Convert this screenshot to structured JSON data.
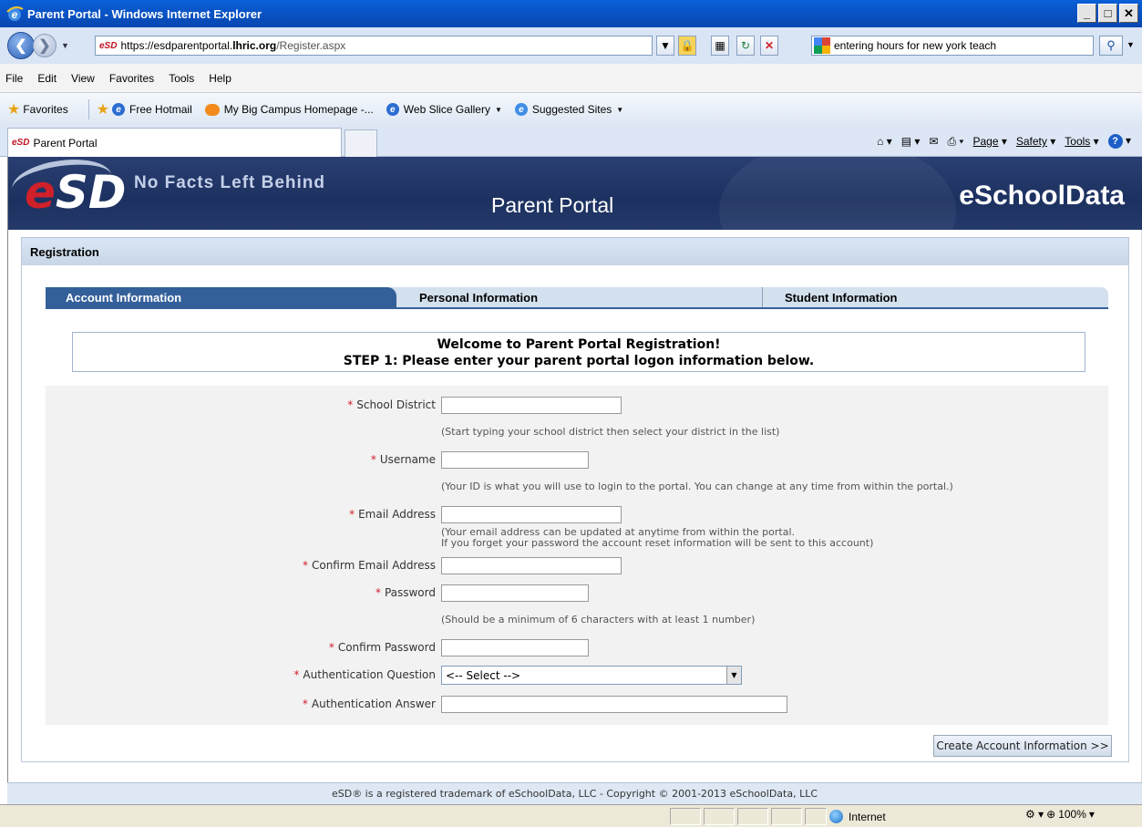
{
  "window": {
    "title": "Parent Portal - Windows Internet Explorer",
    "min": "_",
    "max": "□",
    "close": "✕"
  },
  "address": {
    "url_domain": "https://esdparentportal.",
    "url_domain_bold": "lhric.org",
    "url_path": "/Register.aspx",
    "search_text": "entering hours for new york teach"
  },
  "menu": [
    "File",
    "Edit",
    "View",
    "Favorites",
    "Tools",
    "Help"
  ],
  "favorites": {
    "label": "Favorites",
    "items": [
      "Free Hotmail",
      "My Big Campus Homepage -...",
      "Web Slice Gallery",
      "Suggested Sites"
    ]
  },
  "tab": {
    "label": "Parent Portal"
  },
  "commandbar": {
    "page": "Page",
    "safety": "Safety",
    "tools": "Tools"
  },
  "banner": {
    "logo": "eSD",
    "tagline": "No Facts Left Behind",
    "portal_title": "Parent Portal",
    "brand": "eSchoolData"
  },
  "registration": {
    "header": "Registration",
    "tabs": [
      "Account Information",
      "Personal Information",
      "Student Information"
    ],
    "welcome_line1": "Welcome to Parent Portal Registration!",
    "welcome_line2": "STEP 1: Please enter your parent portal logon information below.",
    "fields": {
      "school_district": "School District",
      "school_district_hint": "(Start typing your school district then select your district in the list)",
      "username": "Username",
      "username_hint": "(Your ID is what you will use to login to the portal. You can change at any time from within the portal.)",
      "email": "Email Address",
      "email_hint_1": "(Your email address can be updated at anytime from within the portal.",
      "email_hint_2": "If you forget your password the account reset information will be sent to this account)",
      "confirm_email": "Confirm Email Address",
      "password": "Password",
      "password_hint": "(Should be a minimum of 6 characters with at least 1 number)",
      "confirm_password": "Confirm Password",
      "auth_question": "Authentication Question",
      "auth_question_value": "<-- Select -->",
      "auth_answer": "Authentication Answer",
      "required_mark": "*"
    },
    "submit": "Create Account Information >>"
  },
  "footer": "eSD® is a registered trademark of eSchoolData, LLC - Copyright © 2001-2013 eSchoolData, LLC",
  "status": {
    "zone": "Internet",
    "zoom": "100%"
  }
}
